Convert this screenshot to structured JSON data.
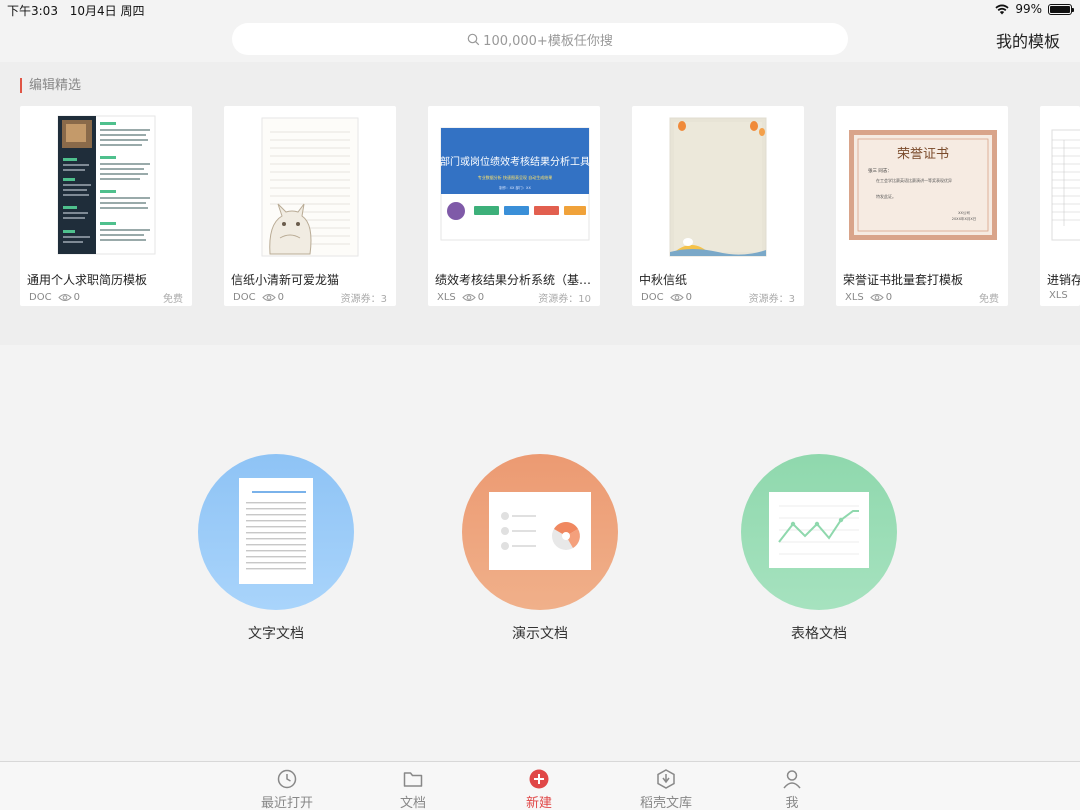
{
  "status_bar": {
    "time": "下午3:03",
    "date": "10月4日 周四",
    "battery": "99%",
    "battery_level": 0.99
  },
  "header": {
    "search_placeholder": "100,000+模板任你搜",
    "my_templates": "我的模板"
  },
  "featured": {
    "section_title": "编辑精选",
    "cards": [
      {
        "title": "通用个人求职简历模板",
        "format": "DOC",
        "views": "0",
        "price": "免费",
        "thumb": "resume"
      },
      {
        "title": "信纸小清新可爱龙猫",
        "format": "DOC",
        "views": "0",
        "price": "资源券：3",
        "thumb": "letter-totoro"
      },
      {
        "title": "绩效考核结果分析系统（基…",
        "format": "XLS",
        "views": "0",
        "price": "资源券：10",
        "thumb": "performance",
        "thumb_text": {
          "main": "部门或岗位绩效考核结果分析工具",
          "sub": "专业数据分析  快速图表呈现  自动生成结果",
          "small": "制作：XX  部门：XX"
        }
      },
      {
        "title": "中秋信纸",
        "format": "DOC",
        "views": "0",
        "price": "资源券：3",
        "thumb": "mid-autumn"
      },
      {
        "title": "荣誉证书批量套打模板",
        "format": "XLS",
        "views": "0",
        "price": "免费",
        "thumb": "certificate",
        "thumb_text": {
          "heading": "荣誉证书",
          "name": "张三 同志：",
          "body": "在工会学比赛英语比赛演讲一等奖表现优异",
          "footer": "特发此证。",
          "org": "XX公司",
          "date": "20XX年X月X日"
        }
      },
      {
        "title": "进销存",
        "format": "XLS",
        "views": "",
        "price": "",
        "thumb": "spreadsheet"
      }
    ]
  },
  "create": {
    "items": [
      {
        "label": "文字文档",
        "color_top": "#8ec3f5",
        "color_bottom": "#a9d4fb",
        "icon": "document-icon"
      },
      {
        "label": "演示文档",
        "color_top": "#ec9a72",
        "color_bottom": "#f0b08a",
        "icon": "presentation-icon"
      },
      {
        "label": "表格文档",
        "color_top": "#8fd8ad",
        "color_bottom": "#a6e2bf",
        "icon": "spreadsheet-icon"
      }
    ]
  },
  "tabbar": {
    "tabs": [
      {
        "label": "最近打开",
        "icon": "clock-icon"
      },
      {
        "label": "文档",
        "icon": "folder-icon"
      },
      {
        "label": "新建",
        "icon": "plus-circle-icon",
        "active": true
      },
      {
        "label": "稻壳文库",
        "icon": "docer-library-icon"
      },
      {
        "label": "我",
        "icon": "user-icon"
      }
    ]
  },
  "colors": {
    "accent_red": "#e04848",
    "section_marker": "#e05545"
  }
}
